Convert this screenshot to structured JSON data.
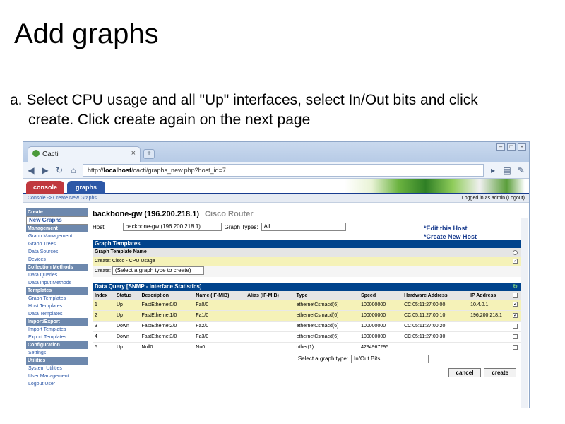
{
  "slide": {
    "title": "Add graphs",
    "instruction_line1": "a. Select CPU usage and all \"Up\" interfaces, select In/Out  bits and click",
    "instruction_line2": "create. Click create again on the next page"
  },
  "browser": {
    "tab_title": "Cacti",
    "tab_close": "×",
    "new_tab": "+",
    "url_prefix": "http://",
    "url_host": "localhost",
    "url_path": "/cacti/graphs_new.php?host_id=7",
    "win_min": "–",
    "win_max": "□",
    "win_close": "×"
  },
  "cacti": {
    "tab_console": "console",
    "tab_graphs": "graphs",
    "breadcrumb": "Console -> Create New Graphs",
    "login": "Logged in as admin (Logout)",
    "menu": [
      {
        "label": "Create",
        "header": true
      },
      {
        "label": "New Graphs",
        "header": false,
        "selected": true
      },
      {
        "label": "Management",
        "header": true
      },
      {
        "label": "Graph Management",
        "header": false
      },
      {
        "label": "Graph Trees",
        "header": false
      },
      {
        "label": "Data Sources",
        "header": false
      },
      {
        "label": "Devices",
        "header": false
      },
      {
        "label": "Collection Methods",
        "header": true
      },
      {
        "label": "Data Queries",
        "header": false
      },
      {
        "label": "Data Input Methods",
        "header": false
      },
      {
        "label": "Templates",
        "header": true
      },
      {
        "label": "Graph Templates",
        "header": false
      },
      {
        "label": "Host Templates",
        "header": false
      },
      {
        "label": "Data Templates",
        "header": false
      },
      {
        "label": "Import/Export",
        "header": true
      },
      {
        "label": "Import Templates",
        "header": false
      },
      {
        "label": "Export Templates",
        "header": false
      },
      {
        "label": "Configuration",
        "header": true
      },
      {
        "label": "Settings",
        "header": false
      },
      {
        "label": "Utilities",
        "header": true
      },
      {
        "label": "System Utilities",
        "header": false
      },
      {
        "label": "User Management",
        "header": false
      },
      {
        "label": "Logout User",
        "header": false
      }
    ],
    "host_title": "backbone-gw (196.200.218.1)",
    "host_type": "Cisco Router",
    "host_label": "Host:",
    "host_value": "backbone-gw (196.200.218.1)",
    "graph_types_label": "Graph Types:",
    "graph_types_value": "All",
    "edit_host": "*Edit this Host",
    "create_new_host": "*Create New Host",
    "graph_templates_header": "Graph Templates",
    "graph_template_name_header": "Graph Template Name",
    "create_cpu": "Create: Cisco - CPU Usage",
    "create_label": "Create:",
    "create_select": "(Select a graph type to create)",
    "dq_header": "Data Query [SNMP - Interface Statistics]",
    "columns": [
      "Index",
      "Status",
      "Description",
      "Name (IF-MIB)",
      "Alias (IF-MIB)",
      "Type",
      "Speed",
      "Hardware Address",
      "IP Address"
    ],
    "rows": [
      {
        "cells": [
          "1",
          "Up",
          "FastEthernet0/0",
          "Fa0/0",
          "",
          "ethernetCsmacd(6)",
          "100000000",
          "CC:05:11:27:00:00",
          "10.4.0.1"
        ],
        "checked": true
      },
      {
        "cells": [
          "2",
          "Up",
          "FastEthernet1/0",
          "Fa1/0",
          "",
          "ethernetCsmacd(6)",
          "100000000",
          "CC:05:11:27:00:10",
          "196.200.218.1"
        ],
        "checked": true
      },
      {
        "cells": [
          "3",
          "Down",
          "FastEthernet2/0",
          "Fa2/0",
          "",
          "ethernetCsmacd(6)",
          "100000000",
          "CC:05:11:27:00:20",
          ""
        ],
        "checked": false
      },
      {
        "cells": [
          "4",
          "Down",
          "FastEthernet3/0",
          "Fa3/0",
          "",
          "ethernetCsmacd(6)",
          "100000000",
          "CC:05:11:27:00:30",
          ""
        ],
        "checked": false
      },
      {
        "cells": [
          "5",
          "Up",
          "Null0",
          "Nu0",
          "",
          "other(1)",
          "4294967295",
          "",
          ""
        ],
        "checked": false
      }
    ],
    "select_graph_type_label": "Select a graph type:",
    "select_graph_type_value": "In/Out Bits",
    "cancel": "cancel",
    "create": "create"
  }
}
